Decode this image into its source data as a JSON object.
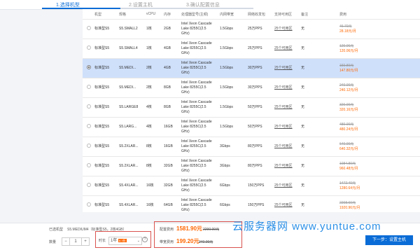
{
  "steps": [
    "1.选择机型",
    "2.设置主机",
    "3.确认配置信息"
  ],
  "table": {
    "headers": [
      "机型",
      "规格",
      "vCPU",
      "内存",
      "处理器型号(主频)",
      "内网带宽",
      "网络收发包",
      "支持可用区",
      "备注",
      "费用"
    ],
    "rows": [
      {
        "type": "标准型S5",
        "spec": "S5.SMALL2",
        "vcpu": "1核",
        "mem": "2GB",
        "cpu": "Intel Xeon Cascade Lake 8255C(2.5 GHz)",
        "bw": "1.5Gbps",
        "pps": "25万PPS",
        "az": "25个可用区",
        "note": "无",
        "old": "46.70元",
        "price": "28.18元/月"
      },
      {
        "type": "标准型S5",
        "spec": "S5.SMALL4",
        "vcpu": "1核",
        "mem": "4GB",
        "cpu": "Intel Xeon Cascade Lake 8255C(2.5 GHz)",
        "bw": "1.5Gbps",
        "pps": "25万PPS",
        "az": "25个可用区",
        "note": "无",
        "old": "120.06元",
        "price": "120.06元/月"
      },
      {
        "type": "标准型S5",
        "spec": "S5.MEDI...",
        "vcpu": "2核",
        "mem": "4GB",
        "cpu": "Intel Xeon Cascade Lake 8255C(2.5 GHz)",
        "bw": "1.5Gbps",
        "pps": "30万PPS",
        "az": "25个可用区",
        "note": "无",
        "old": "150.80元",
        "price": "147.80元/月"
      },
      {
        "type": "标准型S5",
        "spec": "S5.MEDI...",
        "vcpu": "2核",
        "mem": "8GB",
        "cpu": "Intel Xeon Cascade Lake 8255C(2.5 GHz)",
        "bw": "1.5Gbps",
        "pps": "30万PPS",
        "az": "25个可用区",
        "note": "无",
        "old": "240.00元",
        "price": "240.12元/月"
      },
      {
        "type": "标准型S5",
        "spec": "S5.LARGE8",
        "vcpu": "4核",
        "mem": "8GB",
        "cpu": "Intel Xeon Cascade Lake 8255C(2.5 GHz)",
        "bw": "1.5Gbps",
        "pps": "50万PPS",
        "az": "25个可用区",
        "note": "无",
        "old": "320.00元",
        "price": "320.16元/月"
      },
      {
        "type": "标准型S5",
        "spec": "S5.LARG...",
        "vcpu": "4核",
        "mem": "16GB",
        "cpu": "Intel Xeon Cascade Lake 8255C(2.5 GHz)",
        "bw": "1.5Gbps",
        "pps": "50万PPS",
        "az": "25个可用区",
        "note": "无",
        "old": "480.00元",
        "price": "480.24元/月"
      },
      {
        "type": "标准型S5",
        "spec": "S5.2XLAR...",
        "vcpu": "8核",
        "mem": "16GB",
        "cpu": "Intel Xeon Cascade Lake 8255C(2.5 GHz)",
        "bw": "3Gbps",
        "pps": "80万PPS",
        "az": "25个可用区",
        "note": "无",
        "old": "640.00元",
        "price": "640.32元/月"
      },
      {
        "type": "标准型S5",
        "spec": "S5.2XLAR...",
        "vcpu": "8核",
        "mem": "32GB",
        "cpu": "Intel Xeon Cascade Lake 8255C(2.5 GHz)",
        "bw": "3Gbps",
        "pps": "80万PPS",
        "az": "25个可用区",
        "note": "无",
        "old": "1084.80元",
        "price": "960.48元/月"
      },
      {
        "type": "标准型S5",
        "spec": "S5.4XLAR...",
        "vcpu": "16核",
        "mem": "32GB",
        "cpu": "Intel Xeon Cascade Lake 8255C(2.5 GHz)",
        "bw": "6Gbps",
        "pps": "150万PPS",
        "az": "25个可用区",
        "note": "无",
        "old": "1472.40元",
        "price": "1280.64元/月"
      },
      {
        "type": "标准型S5",
        "spec": "S5.4XLAR...",
        "vcpu": "16核",
        "mem": "64GB",
        "cpu": "Intel Xeon Cascade Lake 8255C(2.5 GHz)",
        "bw": "6Gbps",
        "pps": "150万PPS",
        "az": "25个可用区",
        "note": "无",
        "old": "2208.60元",
        "price": "1920.96元/月"
      }
    ]
  },
  "bottom": {
    "selected_label": "已选机型",
    "selected_value": "S5.MEDIUM4（标准型S5，2核4GB）",
    "qty_label": "数量",
    "qty_minus": "−",
    "qty_value": "1",
    "qty_plus": "+",
    "duration_label": "时长",
    "duration_value": "1年",
    "discount_badge": "8.3折",
    "help": "?",
    "config_fee_label": "配置费用",
    "config_fee": "1581.90元",
    "config_fee_old": "2290.00元",
    "bandwidth_fee_label": "带宽费用",
    "bandwidth_fee": "199.20元",
    "bandwidth_fee_old": "240.00元",
    "next_button": "下一步：设置主机"
  },
  "watermark": "云服务器网 www.yuntue.com",
  "colors": {
    "accent": "#0a6cd6",
    "price": "#ff6600",
    "highlight": "#cfe0fb",
    "annotation": "#d9534f",
    "watermark": "#2b8fe6"
  }
}
